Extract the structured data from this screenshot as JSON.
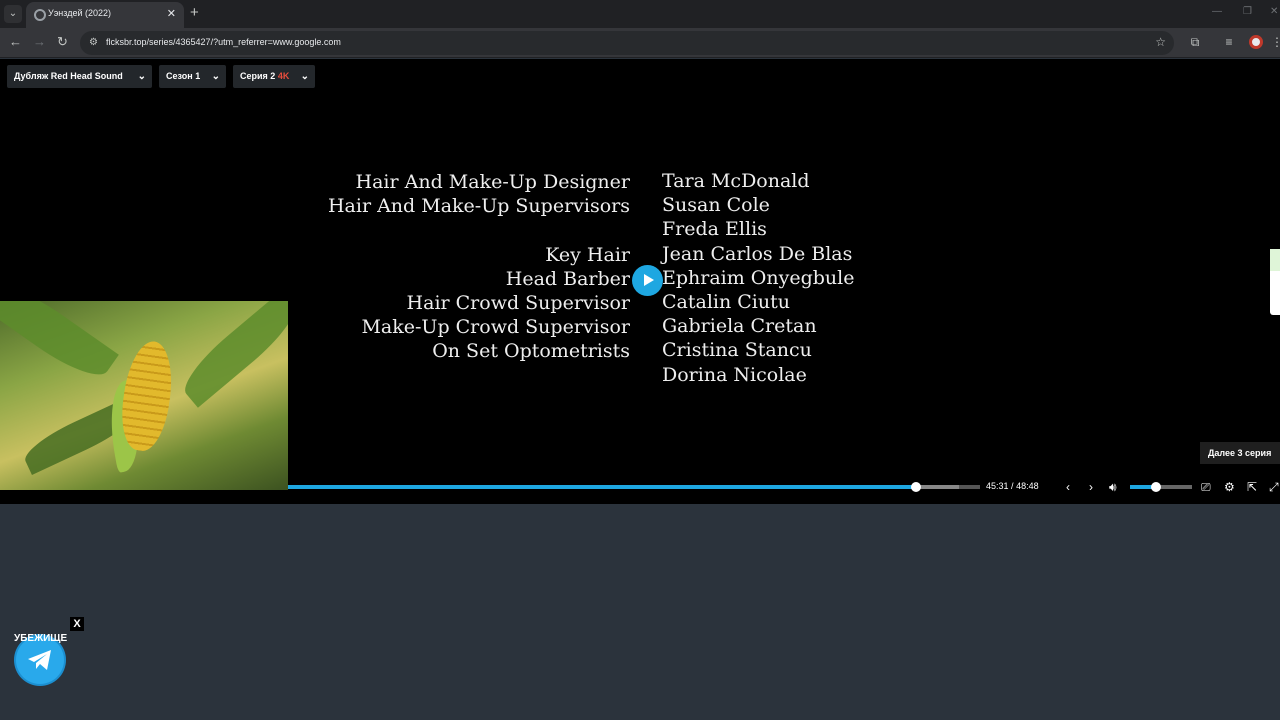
{
  "browser": {
    "tab_title": "Уэнздей (2022)",
    "tab_close": "✕",
    "new_tab": "+",
    "url": "flcksbr.top/series/4365427/?utm_referrer=www.google.com"
  },
  "player": {
    "dub_selector": "Дубляж Red Head Sound",
    "season_selector": "Сезон 1",
    "episode_selector": "Серия 2",
    "episode_quality": "4K",
    "current_time": "45:31",
    "time_separator": "/",
    "duration": "48:48",
    "progress_fraction": 0.907,
    "buffer_fraction": 0.97,
    "volume_fraction": 0.42,
    "next_episode_label": "Далее 3 серия",
    "accent_color": "#1ea7e1"
  },
  "credits": {
    "roles": [
      "Hair And Make-Up Designer",
      "Hair And Make-Up Supervisors",
      "",
      "Key Hair",
      "Head Barber",
      "Hair Crowd Supervisor",
      "Make-Up Crowd Supervisor",
      "On Set Optometrists"
    ],
    "names": [
      "Tara McDonald",
      "Susan Cole",
      "Freda Ellis",
      "Jean Carlos De Blas",
      "Ephraim Onyegbule",
      "Catalin Ciutu",
      "Gabriela Cretan",
      "Cristina Stancu",
      "Dorina Nicolae"
    ]
  },
  "telegram_widget": {
    "label": "УБЕЖИЩЕ",
    "close": "X"
  }
}
